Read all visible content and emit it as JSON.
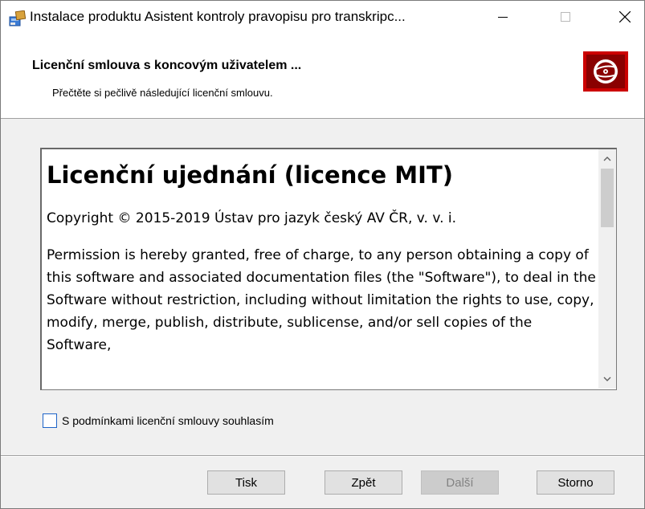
{
  "window": {
    "title": "Instalace produktu Asistent kontroly pravopisu pro transkripc..."
  },
  "header": {
    "title": "Licenční smlouva s koncovým uživatelem ...",
    "subtitle": "Přečtěte si pečlivě následující licenční smlouvu."
  },
  "license": {
    "heading": "Licenční ujednání (licence MIT)",
    "copyright": "Copyright © 2015-2019 Ústav pro jazyk český AV ČR, v. v. i.",
    "body": "Permission is hereby granted, free of charge, to any person obtaining a copy of this software and associated documentation files (the \"Software\"), to deal in the Software without restriction, including without limitation the rights to use, copy, modify, merge, publish, distribute, sublicense, and/or sell copies of the Software,"
  },
  "agree": {
    "label": "S podmínkami licenční smlouvy souhlasím",
    "checked": false
  },
  "buttons": {
    "print": "Tisk",
    "back": "Zpět",
    "next": "Další",
    "cancel": "Storno"
  },
  "colors": {
    "logo_red": "#cc0000",
    "checkbox_border": "#1e64c8"
  },
  "icons": {
    "app": "installer-package-icon",
    "logo": "disc-logo-icon"
  }
}
